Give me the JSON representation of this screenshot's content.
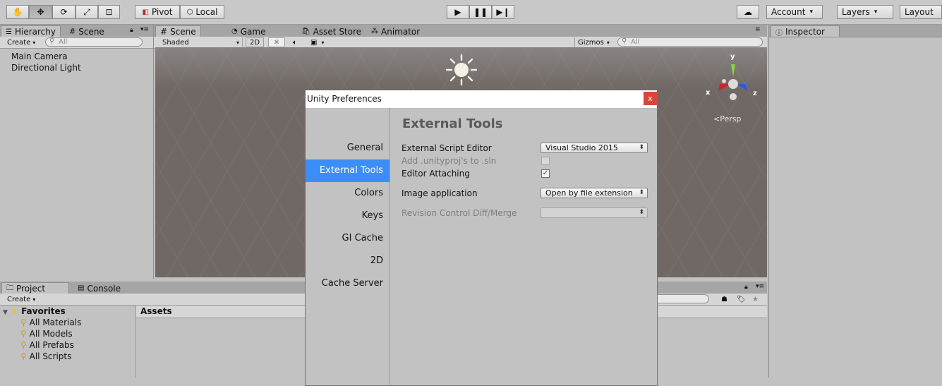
{
  "toolbar": {
    "pivot": "Pivot",
    "local": "Local",
    "account": "Account",
    "layers": "Layers",
    "layout": "Layout"
  },
  "hierarchy": {
    "tab_label": "Hierarchy",
    "scene_tab": "Scene",
    "create": "Create",
    "search_placeholder": "All",
    "items": [
      "Main Camera",
      "Directional Light"
    ]
  },
  "scene_view": {
    "tabs": [
      "Scene",
      "Game",
      "Asset Store",
      "Animator"
    ],
    "shading_mode": "Shaded",
    "mode_2d": "2D",
    "gizmos": "Gizmos",
    "search_placeholder": "All",
    "axes": {
      "x": "x",
      "y": "y",
      "z": "z"
    },
    "projection": "Persp"
  },
  "inspector": {
    "tab_label": "Inspector"
  },
  "preferences": {
    "title": "Unity Preferences",
    "close": "x",
    "nav": [
      "General",
      "External Tools",
      "Colors",
      "Keys",
      "GI Cache",
      "2D",
      "Cache Server"
    ],
    "selected_nav": "External Tools",
    "section_title": "External Tools",
    "rows": {
      "script_editor_label": "External Script Editor",
      "script_editor_value": "Visual Studio 2015",
      "add_proj_label": "Add .unityproj's to .sln",
      "editor_attaching_label": "Editor Attaching",
      "image_app_label": "Image application",
      "image_app_value": "Open by file extension",
      "revision_label": "Revision Control Diff/Merge"
    },
    "add_proj_checked": false,
    "editor_attaching_checked": true
  },
  "project": {
    "tab_label": "Project",
    "console_tab": "Console",
    "create": "Create",
    "favorites_label": "Favorites",
    "favorites": [
      "All Materials",
      "All Models",
      "All Prefabs",
      "All Scripts"
    ],
    "assets_header": "Assets"
  }
}
